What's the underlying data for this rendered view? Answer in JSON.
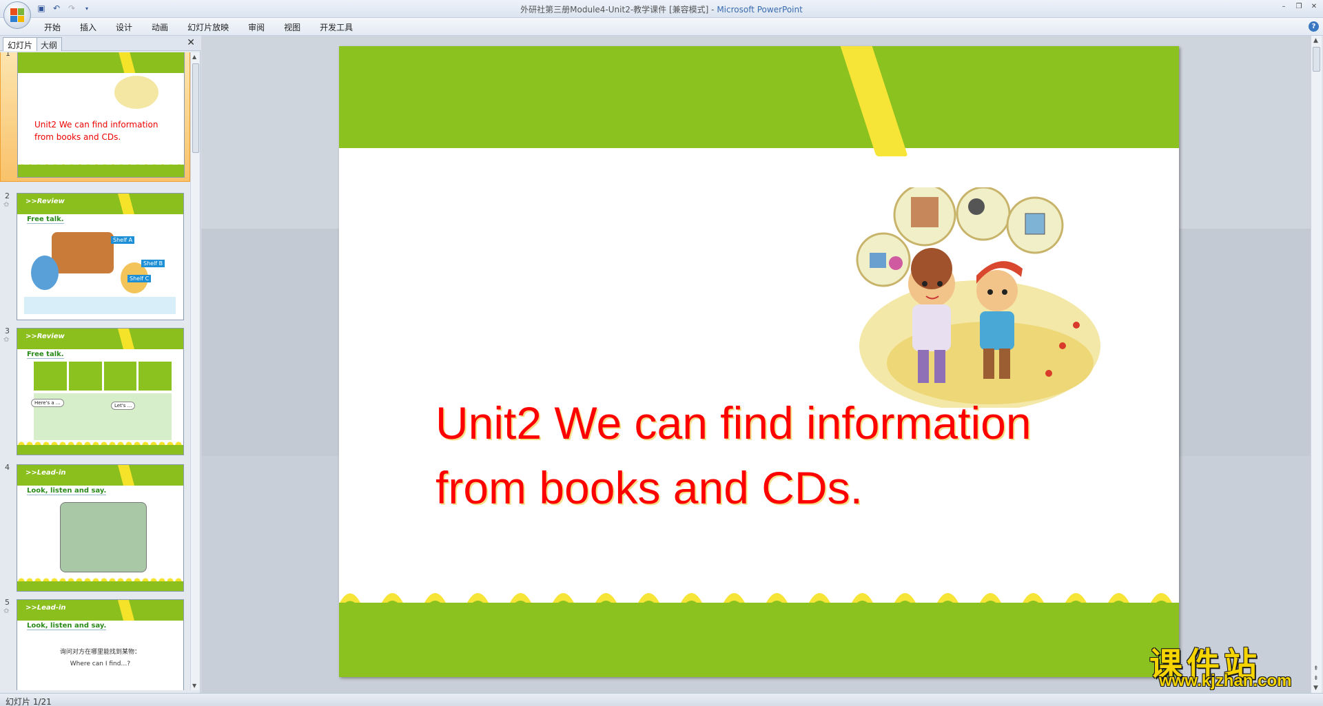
{
  "window": {
    "title_doc": "外研社第三册Module4-Unit2-教学课件 [兼容模式] - ",
    "title_app": "Microsoft PowerPoint"
  },
  "ribbon": {
    "tabs": [
      "开始",
      "插入",
      "设计",
      "动画",
      "幻灯片放映",
      "审阅",
      "视图",
      "开发工具"
    ],
    "help": "?"
  },
  "panel": {
    "tab_slides": "幻灯片",
    "tab_outline": "大纲",
    "close": "✕"
  },
  "thumbnails": [
    {
      "number": "1",
      "title": "Unit2 We can  find information from books and CDs."
    },
    {
      "number": "2",
      "header": ">>Review",
      "subtitle": "Free talk.",
      "labels": [
        "Shelf A",
        "Shelf B",
        "Shelf C"
      ]
    },
    {
      "number": "3",
      "header": ">>Review",
      "subtitle": "Free talk.",
      "bubbles": [
        "Here's a ...",
        "Let's ..."
      ]
    },
    {
      "number": "4",
      "header": ">>Lead-in",
      "subtitle": "Look, listen and say."
    },
    {
      "number": "5",
      "header": ">>Lead-in",
      "subtitle": "Look, listen and say.",
      "notes": [
        "询问对方在哪里能找到某物：",
        "Where can I find…?"
      ]
    }
  ],
  "slide": {
    "title_line1": "Unit2 We can find information",
    "title_line2": "from books and CDs."
  },
  "status": {
    "slide_indicator": "幻灯片 1/21"
  },
  "watermark": {
    "cn": "课件站",
    "url": "www.kjzhan.com"
  },
  "colors": {
    "slide_green": "#8cc21f",
    "slide_yellow": "#f6e437",
    "title_red": "#ff0000"
  }
}
